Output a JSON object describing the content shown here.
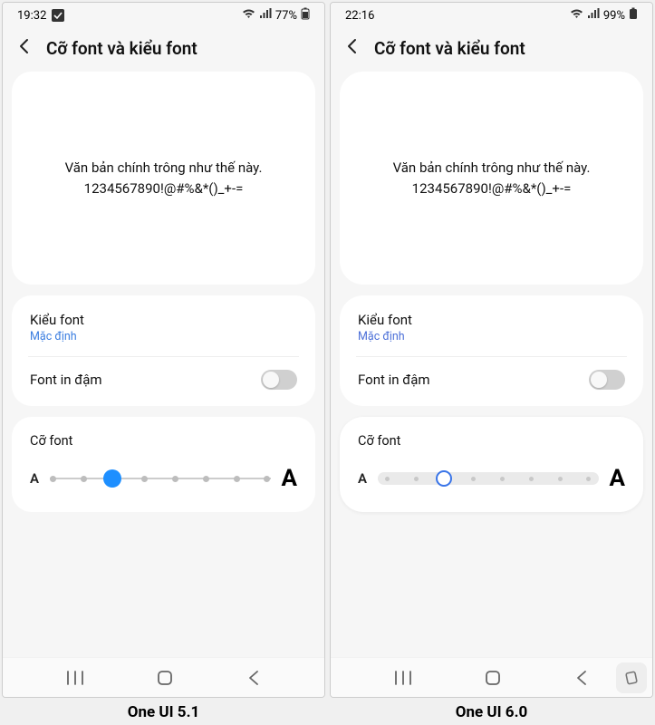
{
  "left": {
    "caption": "One UI 5.1",
    "status": {
      "time": "19:32",
      "battery": "77%"
    },
    "header": {
      "title": "Cỡ font và kiểu font"
    },
    "preview": {
      "line1": "Văn bản chính trông như thế này.",
      "line2": "1234567890!@#%&*()_+-="
    },
    "font_style": {
      "label": "Kiểu font",
      "value": "Mặc định"
    },
    "bold": {
      "label": "Font in đậm",
      "enabled": false
    },
    "size": {
      "label": "Cỡ font",
      "small_letter": "A",
      "large_letter": "A",
      "steps": 8,
      "current_index": 2
    }
  },
  "right": {
    "caption": "One UI 6.0",
    "status": {
      "time": "22:16",
      "battery": "99%"
    },
    "header": {
      "title": "Cỡ font và kiểu font"
    },
    "preview": {
      "line1": "Văn bản chính trông như thế này.",
      "line2": "1234567890!@#%&*()_+-="
    },
    "font_style": {
      "label": "Kiểu font",
      "value": "Mặc định"
    },
    "bold": {
      "label": "Font in đậm",
      "enabled": false
    },
    "size": {
      "label": "Cỡ font",
      "small_letter": "A",
      "large_letter": "A",
      "steps": 8,
      "current_index": 2
    }
  }
}
